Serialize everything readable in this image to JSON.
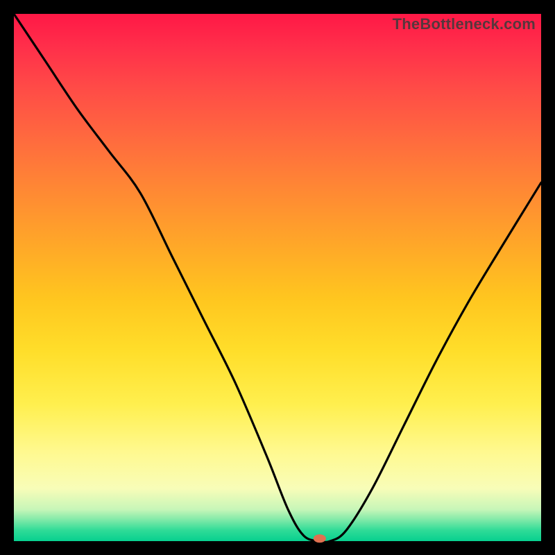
{
  "watermark": "TheBottleneck.com",
  "chart_data": {
    "type": "line",
    "title": "",
    "xlabel": "",
    "ylabel": "",
    "xlim": [
      0,
      100
    ],
    "ylim": [
      0,
      100
    ],
    "grid": false,
    "series": [
      {
        "name": "bottleneck-curve",
        "x": [
          0,
          6,
          12,
          18,
          24,
          30,
          36,
          42,
          48,
          52,
          55,
          58,
          60,
          63,
          68,
          74,
          80,
          86,
          92,
          100
        ],
        "y": [
          100,
          91,
          82,
          74,
          66,
          54,
          42,
          30,
          16,
          6,
          1,
          0,
          0,
          2,
          10,
          22,
          34,
          45,
          55,
          68
        ]
      }
    ],
    "marker": {
      "x": 58,
      "y": 0.5,
      "label": "optimal-point"
    },
    "background_gradient": {
      "top": "#FF1846",
      "mid": "#FFDE2A",
      "bottom": "#07D08F"
    }
  }
}
